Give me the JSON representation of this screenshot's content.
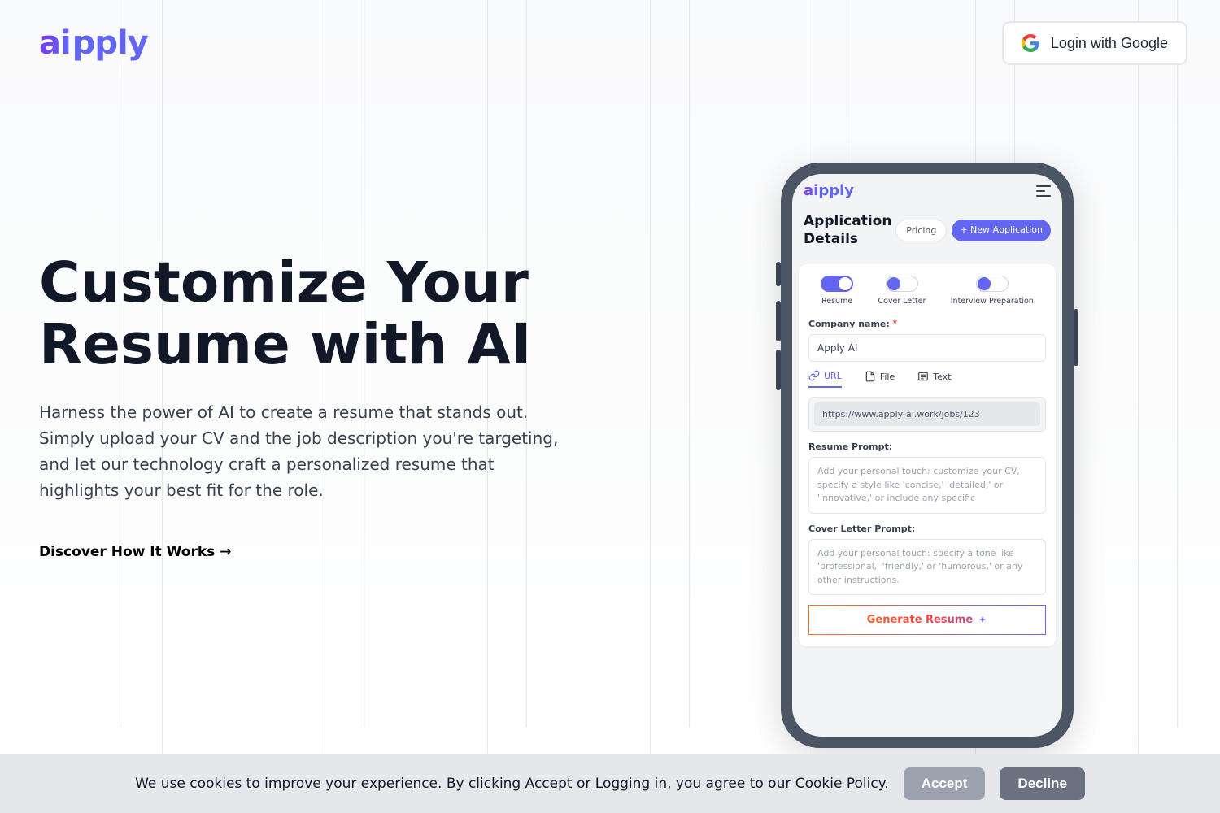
{
  "logo": {
    "ai": "ai",
    "pply": "pply"
  },
  "header": {
    "login": "Login with Google"
  },
  "hero": {
    "title": "Customize Your Resume with AI",
    "description": "Harness the power of AI to create a resume that stands out. Simply upload your CV and the job description you're targeting, and let our technology craft a personalized resume that highlights your best fit for the role.",
    "cta": "Discover How It Works →"
  },
  "phone": {
    "section_title": "Application Details",
    "pricing": "Pricing",
    "new_app": "+ New Application",
    "toggles": {
      "resume": "Resume",
      "cover_letter": "Cover Letter",
      "interview": "Interview Preparation"
    },
    "company_label": "Company name:",
    "company_value": "Apply AI",
    "tabs": {
      "url": "URL",
      "file": "File",
      "text": "Text"
    },
    "url_value": "https://www.apply-ai.work/jobs/123",
    "resume_prompt_label": "Resume Prompt:",
    "resume_prompt_placeholder": "Add your personal touch: customize your CV, specify a style like 'concise,' 'detailed,' or 'innovative,' or include any specific",
    "cover_prompt_label": "Cover Letter Prompt:",
    "cover_prompt_placeholder": "Add your personal touch: specify a tone like 'professional,' 'friendly,' or 'humorous,' or any other instructions.",
    "generate": "Generate Resume"
  },
  "cookie": {
    "text": "We use cookies to improve your experience. By clicking Accept or Logging in, you agree to our Cookie Policy.",
    "accept": "Accept",
    "decline": "Decline"
  }
}
